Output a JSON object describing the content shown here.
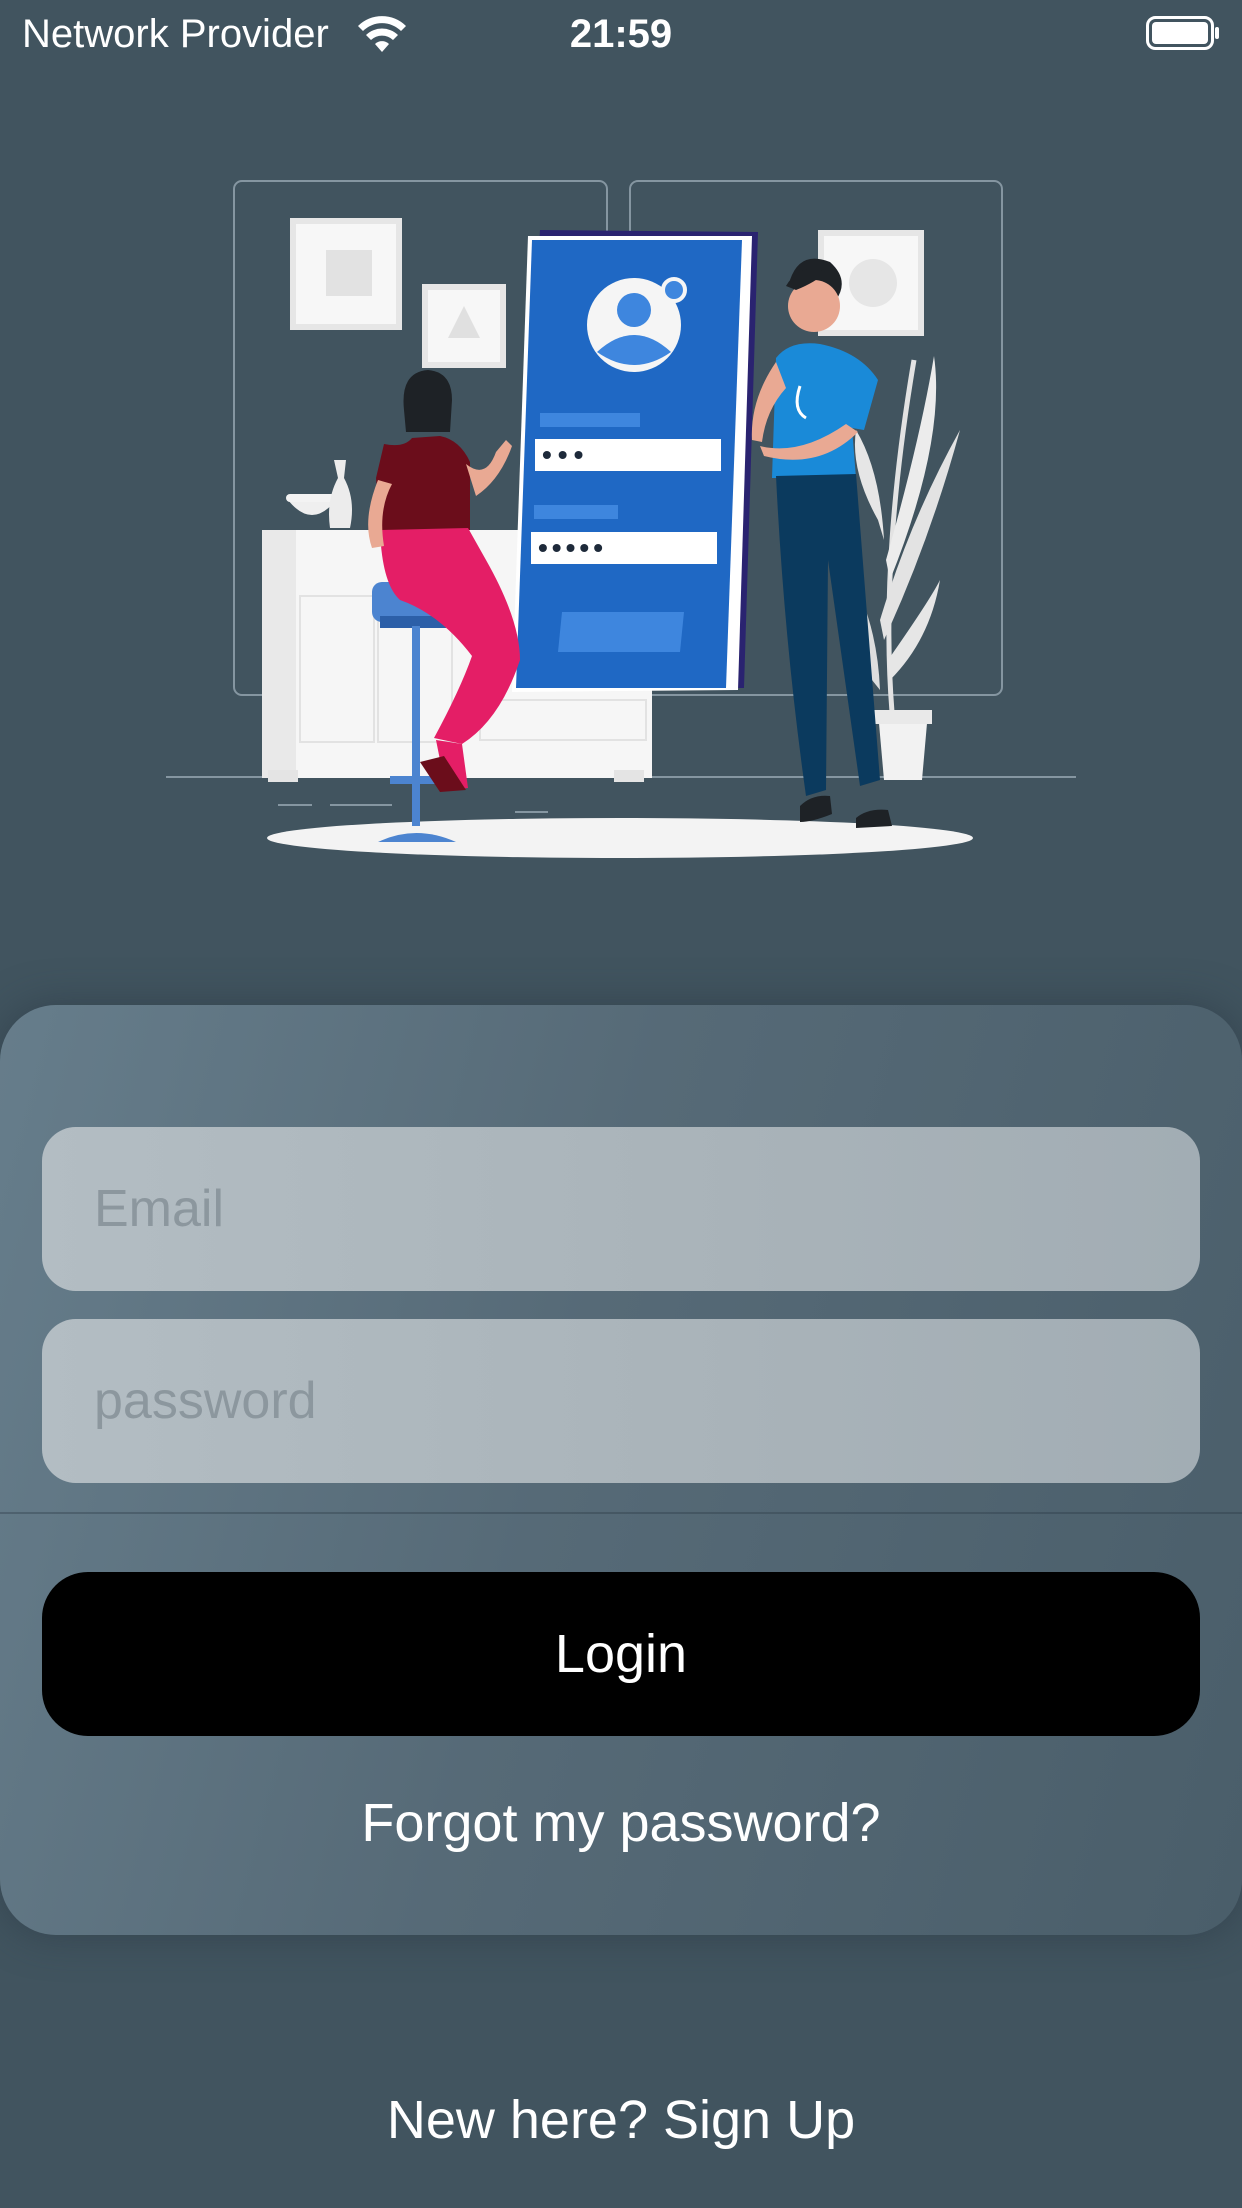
{
  "status_bar": {
    "carrier": "Network Provider",
    "time": "21:59",
    "wifi_icon": "wifi-icon",
    "battery_icon": "battery-icon"
  },
  "hero": {
    "illustration": "login-illustration",
    "username_mask": "•••",
    "password_mask": "•••••"
  },
  "form": {
    "email_placeholder": "Email",
    "email_value": "",
    "password_placeholder": "password",
    "password_value": "",
    "login_label": "Login",
    "forgot_label": "Forgot my password?"
  },
  "footer": {
    "signup_label": "New here? Sign Up"
  },
  "colors": {
    "background": "#41545f",
    "card": "#566a77",
    "field": "#aab4ba",
    "button": "#000000",
    "phone_blue": "#1f68c4",
    "shirt_blue": "#1a8ad8",
    "pants_pink": "#e21f68",
    "pants_navy": "#0b3a5e"
  }
}
